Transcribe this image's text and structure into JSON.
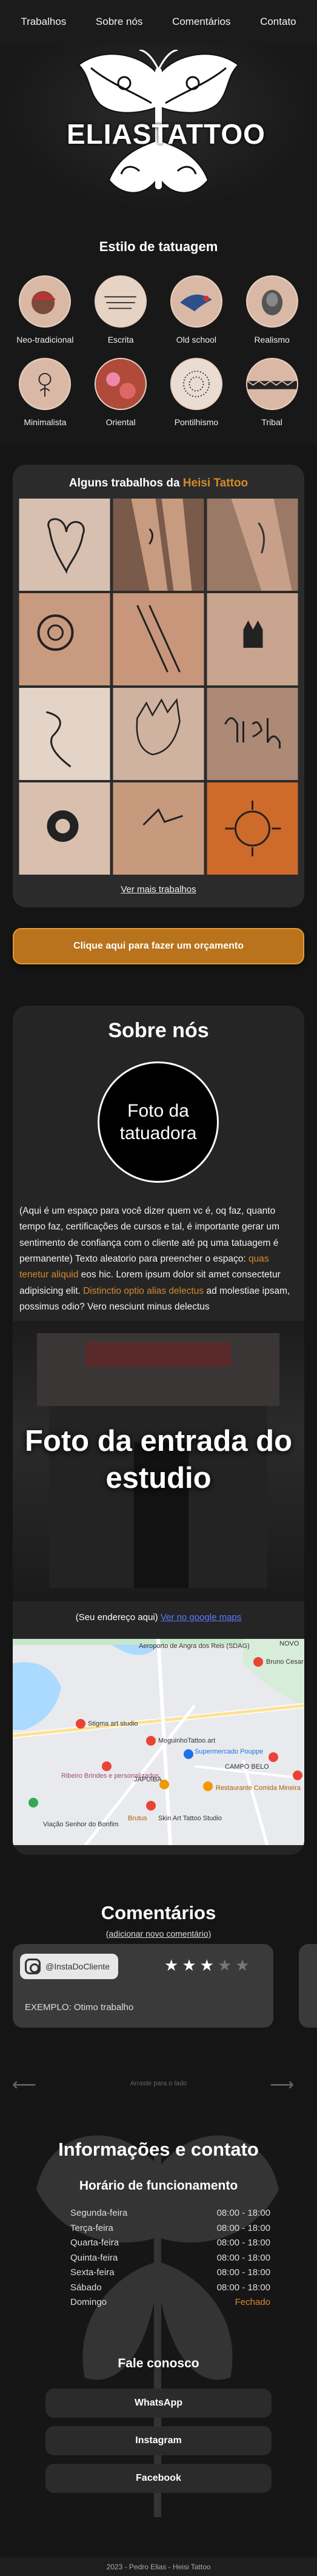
{
  "nav": {
    "items": [
      "Trabalhos",
      "Sobre nós",
      "Comentários",
      "Contato"
    ]
  },
  "brand": {
    "name": "ELIASTATTOO"
  },
  "styles": {
    "title": "Estilo de tatuagem",
    "items": [
      "Neo-tradicional",
      "Escrita",
      "Old school",
      "Realismo",
      "Minimalista",
      "Oriental",
      "Pontilhismo",
      "Tribal"
    ]
  },
  "works": {
    "title_prefix": "Alguns trabalhos da ",
    "title_accent": "Heisi Tattoo",
    "more_link": "Ver mais trabalhos"
  },
  "quote_button": "Clique aqui para fazer um orçamento",
  "about": {
    "title": "Sobre nós",
    "owner_photo_label": "Foto da tatuadora",
    "text_part1": "(Aqui é um espaço para você dizer quem vc é, oq faz, quanto tempo faz, certificações de cursos e tal, é importante gerar um sentimento de confiança com o cliente até pq uma tatuagem é permanente) Texto aleatorio para preencher o espaço: ",
    "text_accent1": "quas tenetur aliquid",
    "text_part2": " eos hic. Lorem ipsum dolor sit amet consectetur adipisicing elit. ",
    "text_accent2": "Distinctio optio alias delectus",
    "text_part3": " ad molestiae ipsam, possimus odio? Vero nesciunt minus delectus",
    "studio_photo_label": "Foto da entrada do estudio",
    "address_label": "(Seu endereço aqui)",
    "address_link": "Ver no google maps",
    "map_labels": {
      "airport": "Aeroporto de Angra dos Reis (SDAG)",
      "bruno": "Bruno Cesar",
      "stigma": "Stigma art studio",
      "moguinho": "MoguinhoTattoo.art",
      "supermarket": "Supermercado Pouppe",
      "campo": "CAMPO BELO",
      "ribeiro": "Ribeiro Brindes e personalizados",
      "restaurant": "Restaurante Comida Mineira",
      "japuiba": "JAPUIBA",
      "brutus": "Brutus",
      "skin": "Skin Art Tattoo Studio",
      "viacao": "Viação Senhor do Bonfim",
      "novo": "NOVO"
    }
  },
  "comments": {
    "title": "Comentários",
    "add_link": "(adicionar novo comentário)",
    "handle": "@InstaDoCliente",
    "rating": 3,
    "max_rating": 5,
    "text": "EXEMPLO: Otimo trabalho",
    "swipe_hint": "Arraste para o lado"
  },
  "contact": {
    "title": "Informações e contato",
    "hours_title": "Horário de funcionamento",
    "hours": [
      {
        "day": "Segunda-feira",
        "time": "08:00 - 18:00"
      },
      {
        "day": "Terça-feira",
        "time": "08:00 - 18:00"
      },
      {
        "day": "Quarta-feira",
        "time": "08:00 - 18:00"
      },
      {
        "day": "Quinta-feira",
        "time": "08:00 - 18:00"
      },
      {
        "day": "Sexta-feira",
        "time": "08:00 - 18:00"
      },
      {
        "day": "Sábado",
        "time": "08:00 - 18:00"
      },
      {
        "day": "Domingo",
        "time": "Fechado"
      }
    ],
    "talk_title": "Fale conosco",
    "social": [
      "WhatsApp",
      "Instagram",
      "Facebook"
    ]
  },
  "footer": "2023 - Pedro Elias - Heisi Tattoo"
}
